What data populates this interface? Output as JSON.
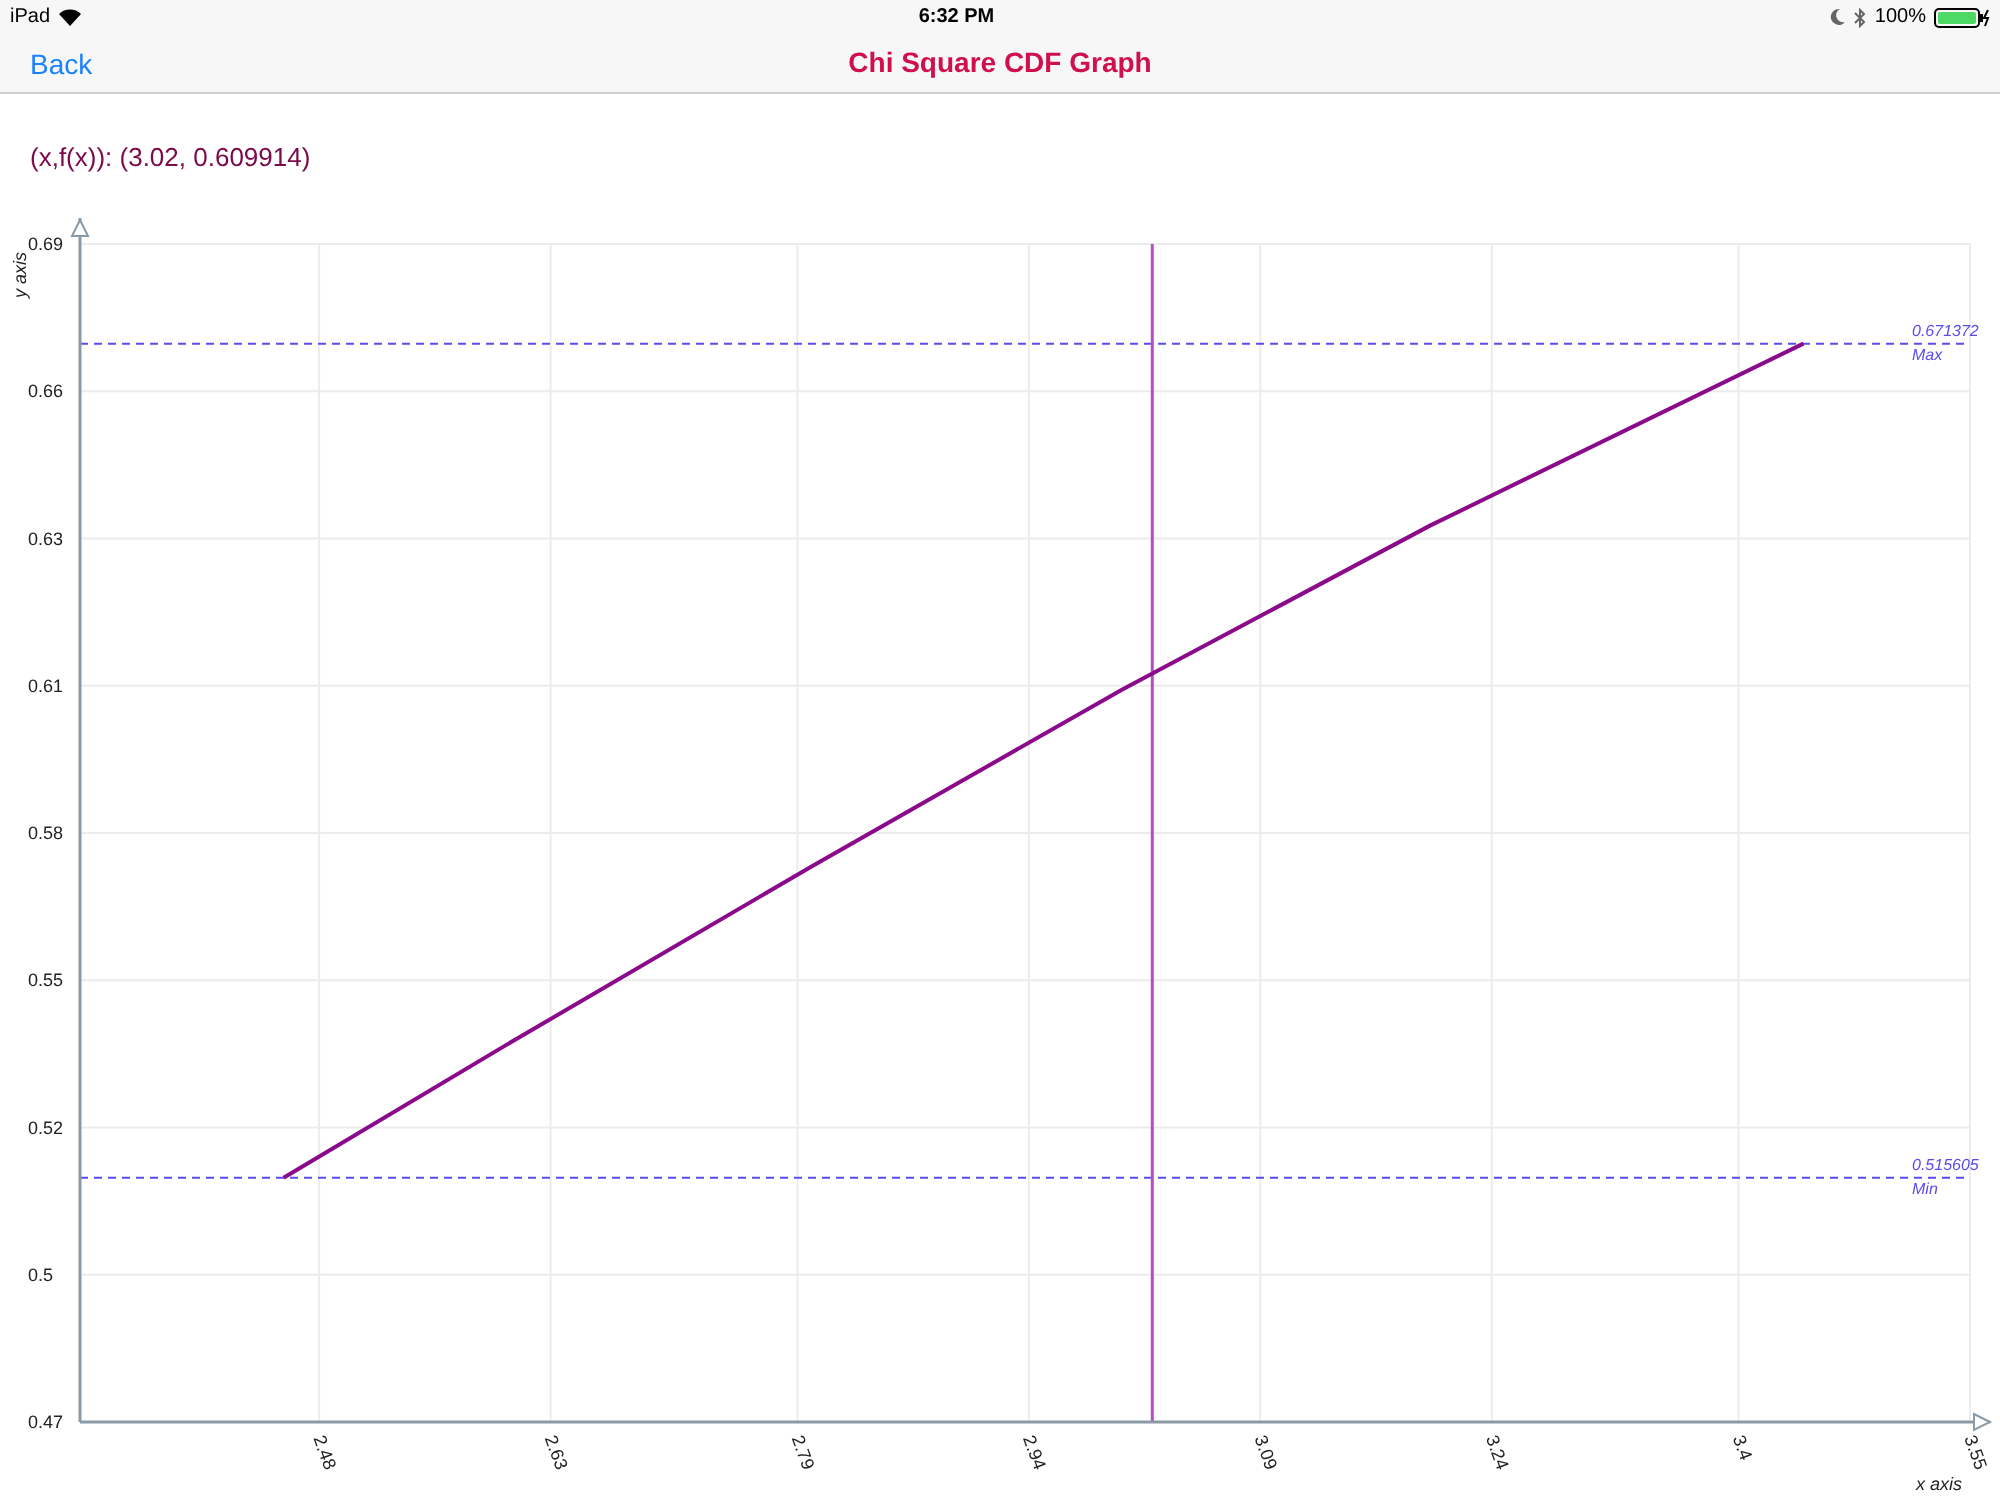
{
  "status_bar": {
    "device": "iPad",
    "time": "6:32 PM",
    "battery": "100%"
  },
  "nav_bar": {
    "back": "Back",
    "title": "Chi Square CDF Graph"
  },
  "readout": "(x,f(x)): (3.02, 0.609914)",
  "chart": {
    "chart_data": {
      "type": "line",
      "xlabel": "x axis",
      "ylabel": "y axis",
      "xlim": [
        2.325,
        3.55
      ],
      "ylim": [
        0.47,
        0.69
      ],
      "grid": true,
      "xticks": [
        {
          "value": 2.48,
          "label": "2.48"
        },
        {
          "value": 2.63,
          "label": "2.63"
        },
        {
          "value": 2.79,
          "label": "2.79"
        },
        {
          "value": 2.94,
          "label": "2.94"
        },
        {
          "value": 3.09,
          "label": "3.09"
        },
        {
          "value": 3.24,
          "label": "3.24"
        },
        {
          "value": 3.4,
          "label": "3.4"
        },
        {
          "value": 3.55,
          "label": "3.55"
        }
      ],
      "yticks": [
        {
          "value": 0.47,
          "label": "0.47"
        },
        {
          "value": 0.4975,
          "label": "0.5"
        },
        {
          "value": 0.525,
          "label": "0.52"
        },
        {
          "value": 0.5525,
          "label": "0.55"
        },
        {
          "value": 0.58,
          "label": "0.58"
        },
        {
          "value": 0.6075,
          "label": "0.61"
        },
        {
          "value": 0.635,
          "label": "0.63"
        },
        {
          "value": 0.6625,
          "label": "0.66"
        },
        {
          "value": 0.69,
          "label": "0.69"
        }
      ],
      "x": [
        2.457,
        2.6,
        2.8,
        3.0,
        3.2,
        3.442
      ],
      "series": [
        {
          "color": "#8b0a8b",
          "values": [
            0.5156,
            0.5402,
            0.5739,
            0.6067,
            0.6374,
            0.6714
          ]
        }
      ],
      "ref_lines": [
        {
          "axis": "y",
          "value": 0.671372,
          "label": "0.671372",
          "color": "#5a4cf0"
        },
        {
          "axis": "y",
          "value": 0.515605,
          "label": "0.515605",
          "color": "#5a4cf0"
        },
        {
          "axis": "x",
          "value": 3.02,
          "color": "#b84cc8"
        }
      ],
      "annotations": [
        {
          "text": "Max"
        },
        {
          "text": "Min"
        }
      ]
    }
  }
}
